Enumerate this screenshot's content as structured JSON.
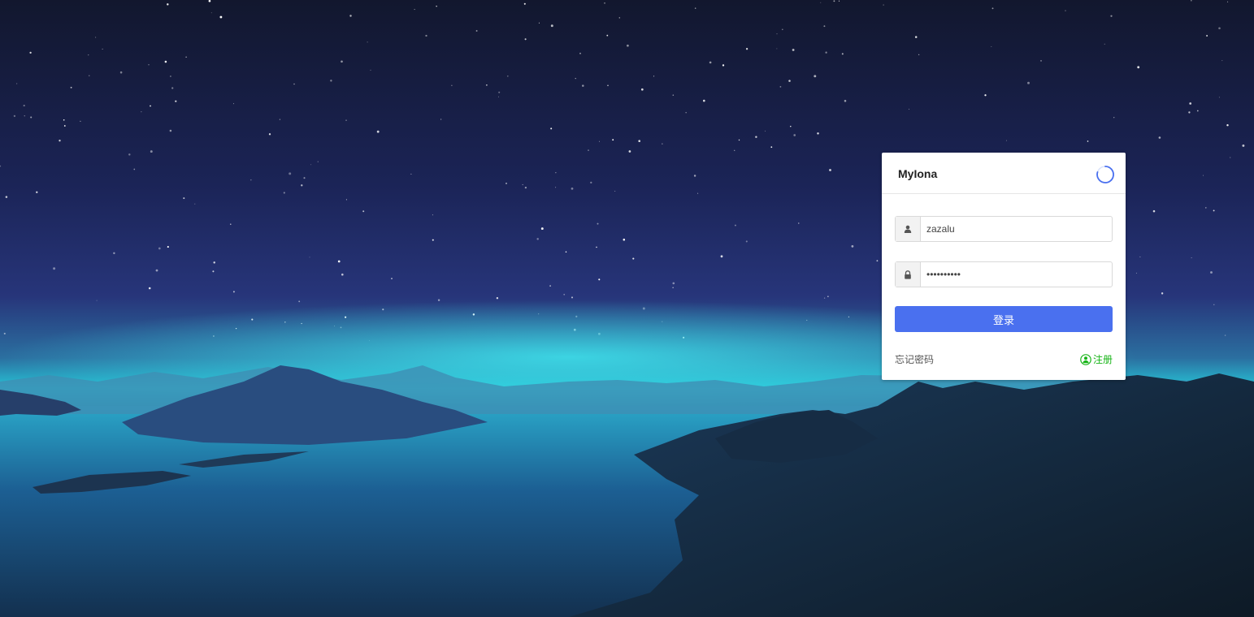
{
  "brand": "MyIona",
  "username": {
    "value": "zazalu",
    "icon": "user-icon"
  },
  "password": {
    "value": "••••••••••",
    "icon": "lock-icon"
  },
  "login_label": "登录",
  "forgot_label": "忘记密码",
  "register_label": "注册",
  "colors": {
    "primary": "#4a70ef",
    "register": "#17b417"
  }
}
